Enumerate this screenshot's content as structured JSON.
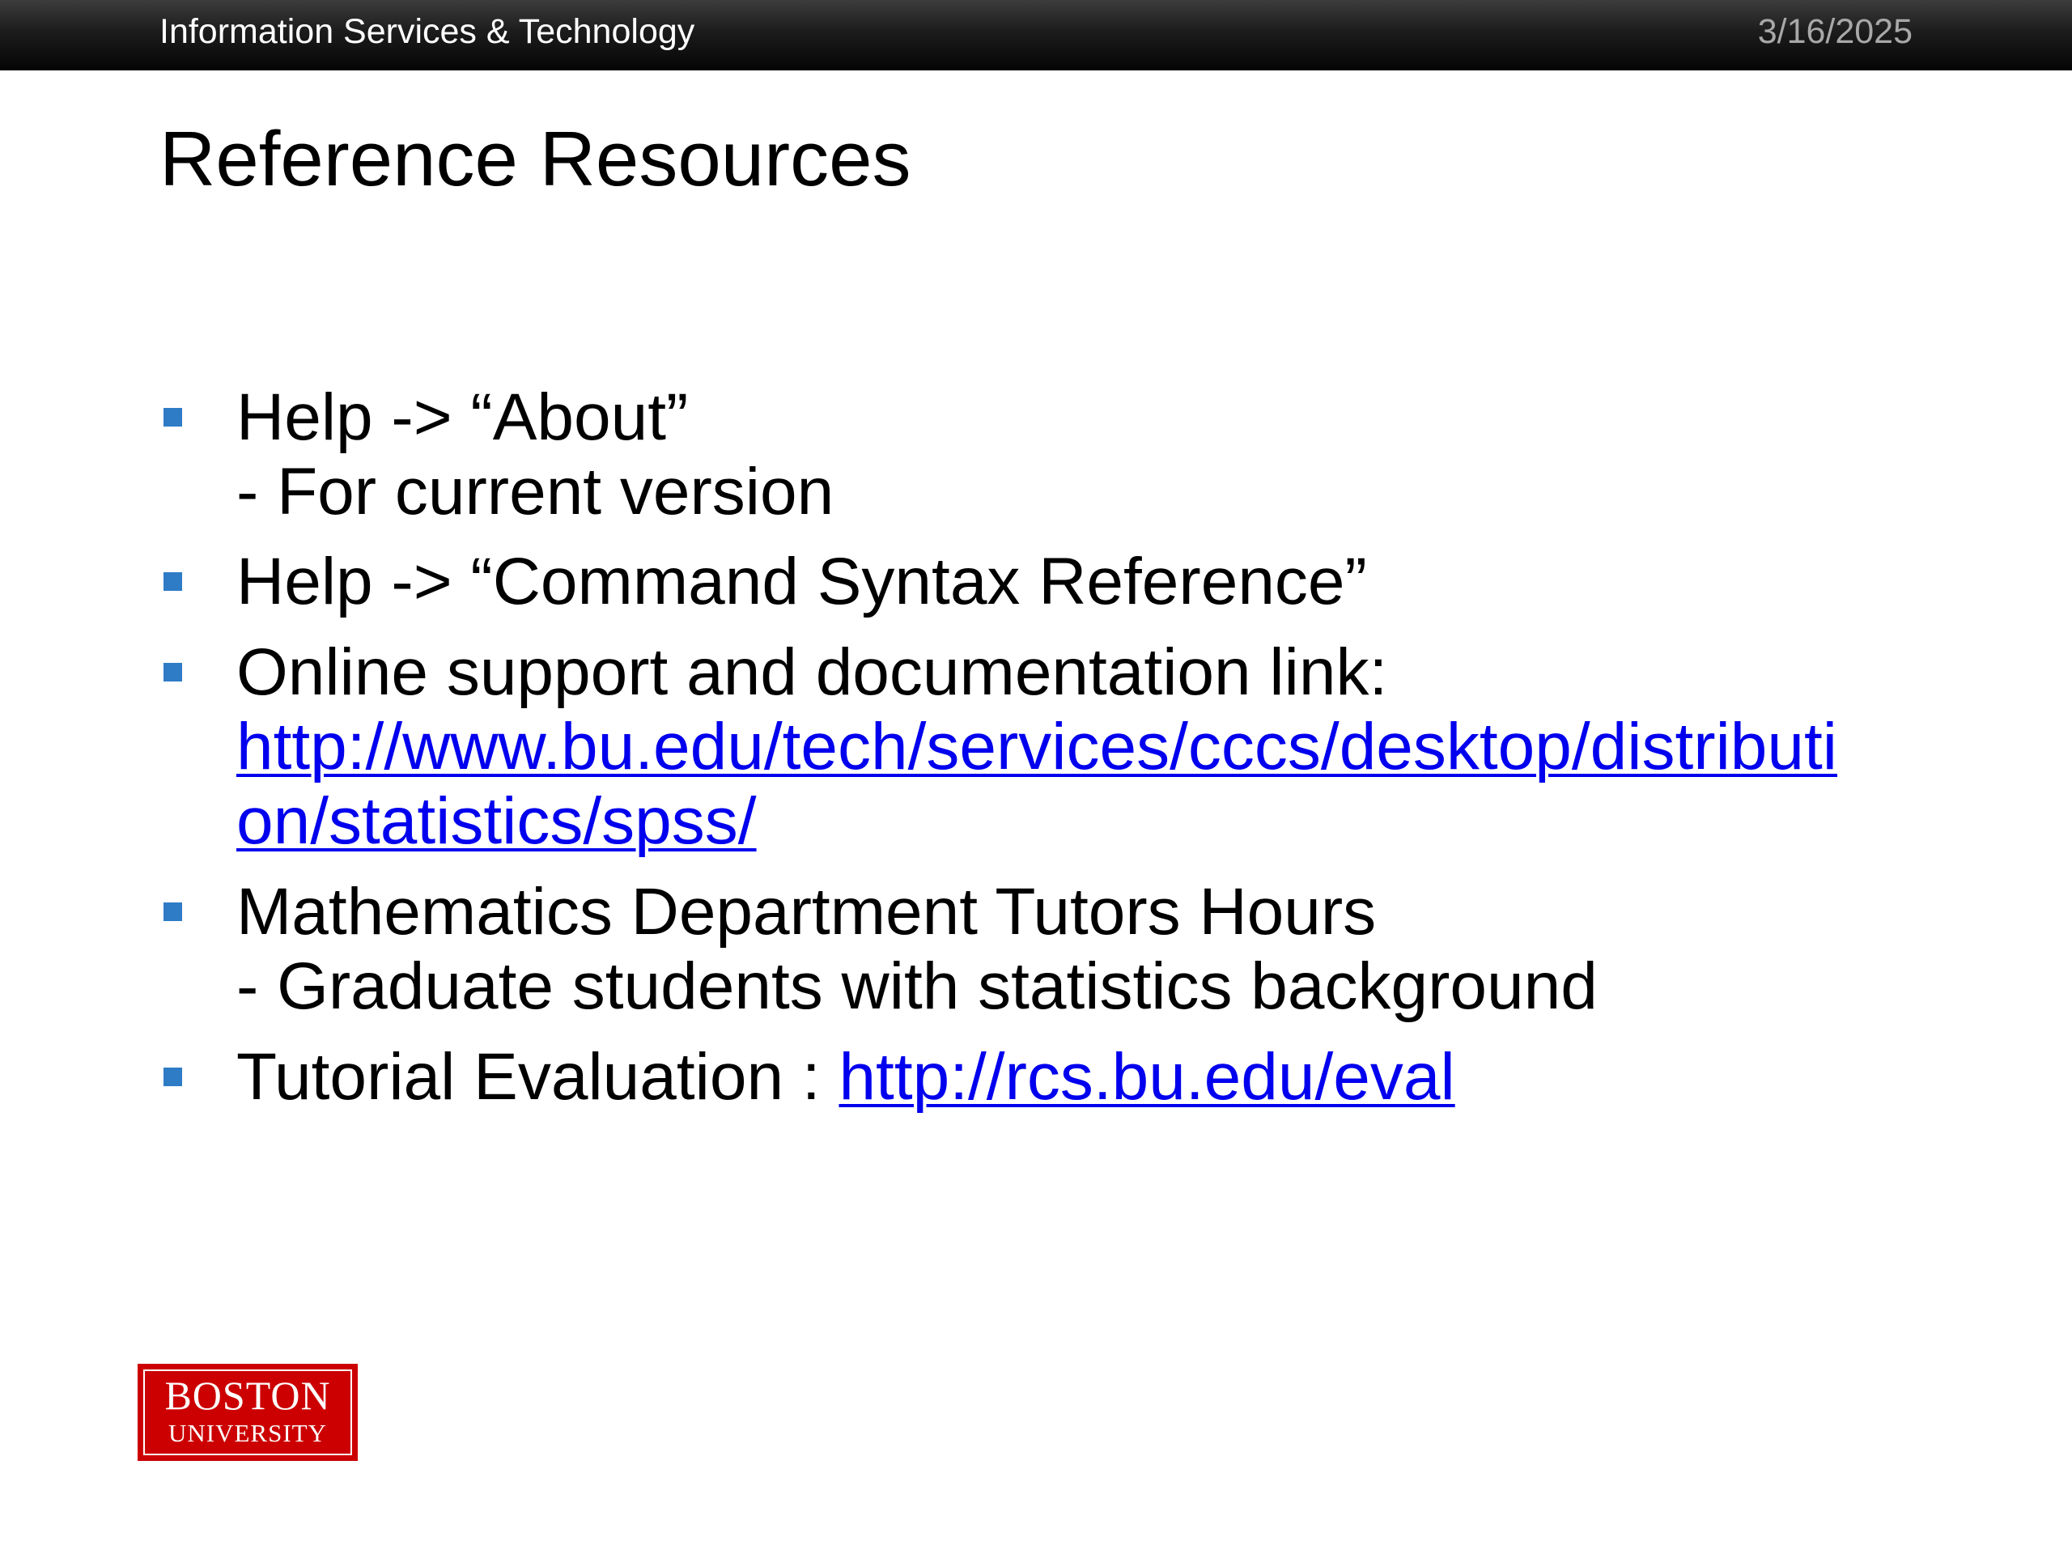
{
  "header": {
    "organization": "Information Services & Technology",
    "date": "3/16/2025"
  },
  "slide": {
    "title": "Reference Resources",
    "bullets": [
      {
        "line1": "Help -> “About”",
        "line2": "- For current version"
      },
      {
        "line1": "Help -> “Command Syntax Reference”"
      },
      {
        "line1": "Online support and documentation link:",
        "link_line1": "http://www.bu.edu/tech/services/cccs/desktop/distributi",
        "link_line2": "on/statistics/spss/"
      },
      {
        "line1": "Mathematics Department Tutors Hours",
        "line2": "- Graduate students with statistics background"
      },
      {
        "text": "Tutorial Evaluation : ",
        "link": "http://rcs.bu.edu/eval"
      }
    ]
  },
  "logo": {
    "line1": "BOSTON",
    "line2": "UNIVERSITY"
  },
  "colors": {
    "bullet": "#2e7cc6",
    "link": "#0000ee",
    "logo_red": "#cc0000"
  }
}
